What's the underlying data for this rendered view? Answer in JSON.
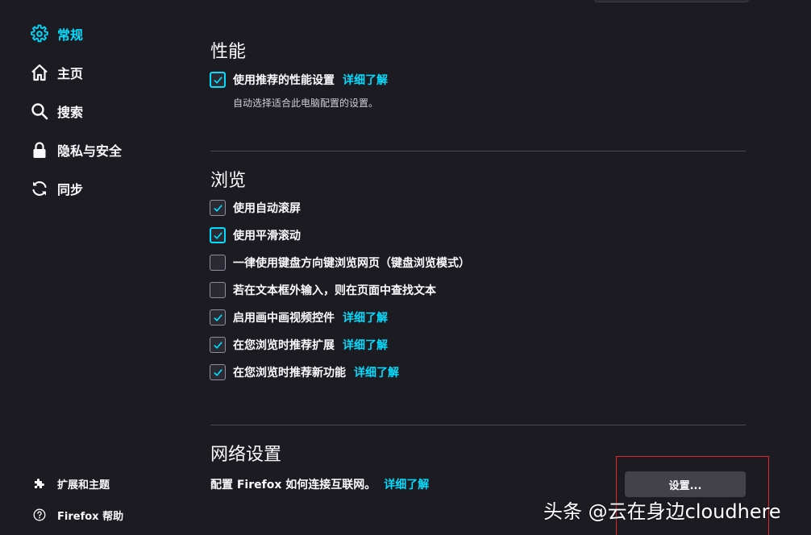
{
  "sidebar": {
    "items": [
      {
        "label": "常规",
        "icon": "gear-icon",
        "active": true
      },
      {
        "label": "主页",
        "icon": "home-icon"
      },
      {
        "label": "搜索",
        "icon": "search-icon"
      },
      {
        "label": "隐私与安全",
        "icon": "lock-icon"
      },
      {
        "label": "同步",
        "icon": "sync-icon"
      }
    ],
    "footer": [
      {
        "label": "扩展和主题",
        "icon": "puzzle-icon"
      },
      {
        "label": "Firefox 帮助",
        "icon": "help-icon"
      }
    ]
  },
  "performance": {
    "title": "性能",
    "recommended": {
      "label": "使用推荐的性能设置",
      "checked": true,
      "link": "详细了解"
    },
    "description": "自动选择适合此电脑配置的设置。"
  },
  "browsing": {
    "title": "浏览",
    "options": [
      {
        "label": "使用自动滚屏",
        "checked": true
      },
      {
        "label": "使用平滑滚动",
        "checked": true
      },
      {
        "label": "一律使用键盘方向键浏览网页（键盘浏览模式）",
        "checked": false
      },
      {
        "label": "若在文本框外输入，则在页面中查找文本",
        "checked": false
      },
      {
        "label": "启用画中画视频控件",
        "checked": true,
        "link": "详细了解"
      },
      {
        "label": "在您浏览时推荐扩展",
        "checked": true,
        "link": "详细了解"
      },
      {
        "label": "在您浏览时推荐新功能",
        "checked": true,
        "link": "详细了解"
      }
    ]
  },
  "network": {
    "title": "网络设置",
    "description": "配置 Firefox 如何连接互联网。",
    "link": "详细了解",
    "button": "设置..."
  },
  "watermark": "头条 @云在身边cloudhere",
  "colors": {
    "accent": "#00ddff",
    "background": "#1c1b22",
    "highlight": "#e2262c"
  }
}
